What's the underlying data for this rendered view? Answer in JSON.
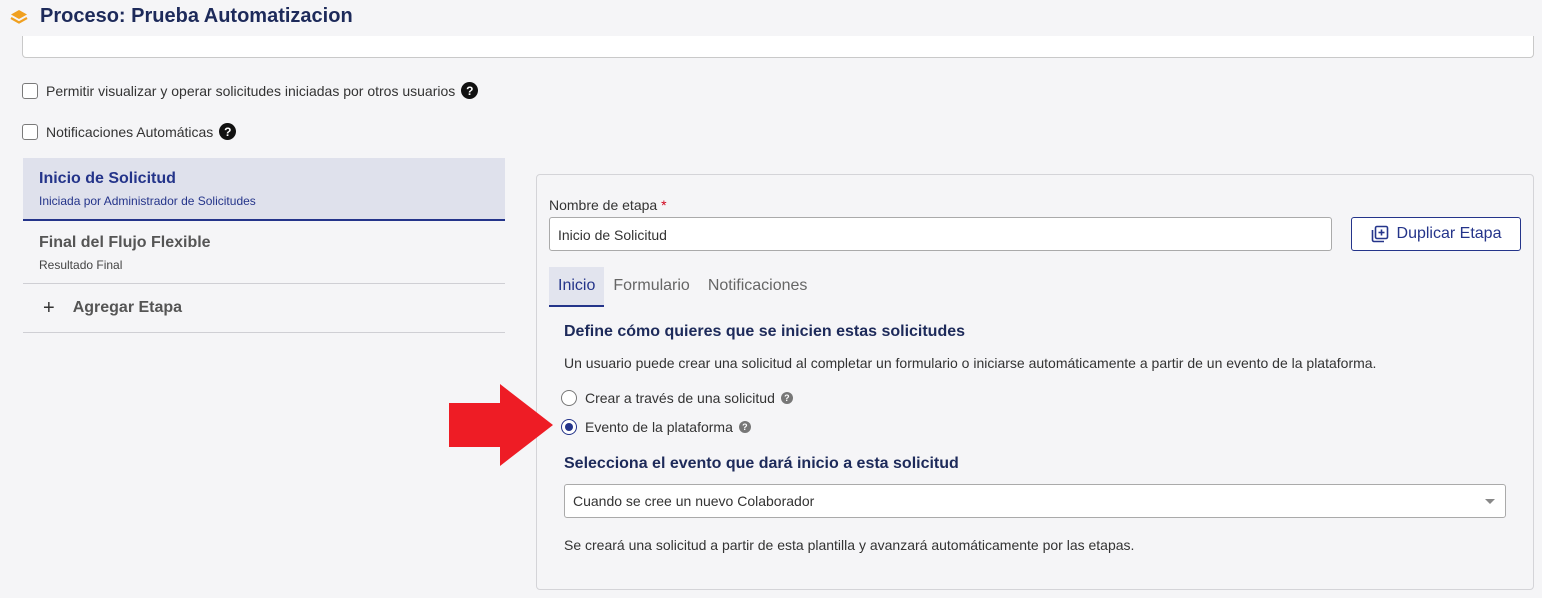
{
  "header": {
    "title": "Proceso: Prueba Automatizacion",
    "logo_icon": "layers-icon",
    "accent": "#f0a020"
  },
  "options": {
    "allow_view": "Permitir visualizar y operar solicitudes iniciadas por otros usuarios",
    "auto_notifications": "Notificaciones Automáticas"
  },
  "stages": [
    {
      "name": "Inicio de Solicitud",
      "sub": "Iniciada por Administrador de Solicitudes"
    },
    {
      "name": "Final del Flujo Flexible",
      "sub": "Resultado Final"
    }
  ],
  "add_stage": "Agregar Etapa",
  "panel": {
    "name_label": "Nombre de etapa",
    "required_mark": "*",
    "name_value": "Inicio de Solicitud",
    "duplicate_label": "Duplicar Etapa",
    "tabs": [
      "Inicio",
      "Formulario",
      "Notificaciones"
    ],
    "define_title": "Define cómo quieres que se inicien estas solicitudes",
    "define_desc": "Un usuario puede crear una solicitud al completar un formulario o iniciarse automáticamente a partir de un evento de la plataforma.",
    "radio_request": "Crear a través de una solicitud",
    "radio_event": "Evento de la plataforma",
    "event_title": "Selecciona el evento que dará inicio a esta solicitud",
    "event_value": "Cuando se cree un nuevo Colaborador",
    "event_note": "Se creará una solicitud a partir de esta plantilla y avanzará automáticamente por las etapas."
  },
  "colors": {
    "brand": "#24348a",
    "arrow": "#ee1c25"
  }
}
